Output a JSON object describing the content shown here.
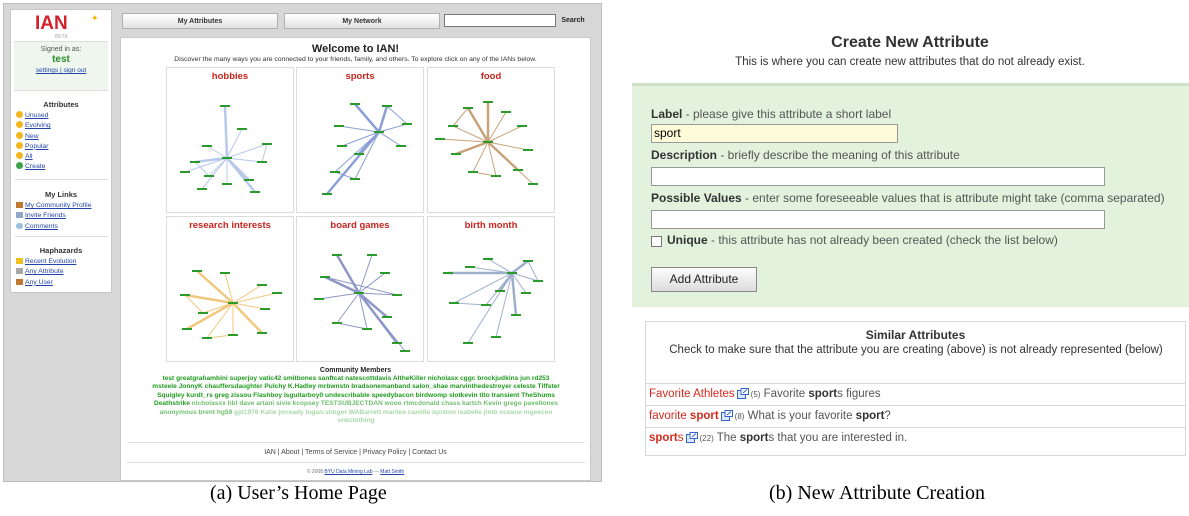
{
  "left_panel": {
    "logo": "IAN",
    "beta": "BETA",
    "signed_in_as": "Signed in as:",
    "username": "test",
    "settings": "settings",
    "sign_out": "sign out",
    "attributes_title": "Attributes",
    "attributes": [
      "Unused",
      "Evolving",
      "New",
      "Popular",
      "All",
      "Create"
    ],
    "links_title": "My Links",
    "links": [
      "My Community Profile",
      "Invite Friends",
      "Comments"
    ],
    "hap_title": "Haphazards",
    "haphazards": [
      "Recent Evolution",
      "Any Attribute",
      "Any User"
    ],
    "tabs": [
      "My Attributes",
      "My Network"
    ],
    "search_button": "Search",
    "welcome": "Welcome to IAN!",
    "discover": "Discover the many ways you are connected to your friends, family, and others. To explore click on any of the IANs below.",
    "graphs": [
      "hobbies",
      "sports",
      "food",
      "research interests",
      "board games",
      "birth month"
    ],
    "community_title": "Community Members",
    "members": [
      "test",
      "greatgrahambini",
      "superjoy",
      "vatic42",
      "smitbones",
      "sanftcat",
      "natescottdavis",
      "AltheKiller",
      "nicholasx",
      "cggc",
      "brockjudkins",
      "jun",
      "rd253",
      "msteele",
      "JonnyK",
      "chauffersdaughter",
      "Pulchy",
      "K.Hadley",
      "mrbwnstn",
      "bradsonemanband",
      "salon_shae",
      "marvinthedestroyer",
      "celeste",
      "Tiffster",
      "Squigley",
      "kurdt_rs",
      "greg",
      "zissou",
      "Flashboy",
      "Isguitarboy0",
      "undescribable",
      "speedybacon",
      "birdwomp",
      "slotkevin",
      "tito",
      "transient",
      "TheShums",
      "Deathstrike",
      "nicholasxx",
      "hbl",
      "dave",
      "artani",
      "sivie",
      "kcopsey",
      "TESTSUBJECTDAN",
      "wooo",
      "rtmcdonald",
      "chass",
      "kartch",
      "Kevin",
      "grego",
      "paveltones",
      "anonymous",
      "brent",
      "hg59",
      "gjd1976",
      "Katie",
      "jmready",
      "logan.stinger",
      "WABarrett",
      "marilee",
      "camille",
      "bpixton",
      "isabelle",
      "jimb",
      "oceane",
      "mgeecen",
      "snkclothing"
    ],
    "footer": "IAN | About | Terms of Service | Privacy Policy | Contact Us",
    "copyright_prefix": "© 2008",
    "copyright_lab": "BYU Data Mining Lab",
    "copyright_sep": "—",
    "copyright_author": "Matt Smith"
  },
  "right_panel": {
    "title": "Create New Attribute",
    "subtitle": "This is where you can create new attributes that do not already exist.",
    "label_name": "Label",
    "label_hint": " - please give this attribute a short label",
    "label_value": "sport",
    "desc_name": "Description",
    "desc_hint": " - briefly describe the meaning of this attribute",
    "desc_value": "",
    "values_name": "Possible Values",
    "values_hint": " - enter some foreseeable values that is attribute might take (comma separated)",
    "values_value": "",
    "unique_name": "Unique",
    "unique_hint": " - this attribute has not already been created (check the list below)",
    "unique_checked": false,
    "add_button": "Add Attribute",
    "similar_title": "Similar Attributes",
    "similar_desc": "Check to make sure that the attribute you are creating (above) is not already represented (below)",
    "similar": [
      {
        "pre": "Favorite Athletes",
        "bold": "",
        "post": "",
        "count": "(5)",
        "d_pre": "Favorite ",
        "d_bold": "sport",
        "d_post": "s figures"
      },
      {
        "pre": "favorite ",
        "bold": "sport",
        "post": "",
        "count": "(8)",
        "d_pre": "What is your favorite ",
        "d_bold": "sport",
        "d_post": "?"
      },
      {
        "pre": "",
        "bold": "sport",
        "post": "s",
        "count": "(22)",
        "d_pre": "The ",
        "d_bold": "sport",
        "d_post": "s that you are interested in."
      }
    ]
  },
  "captions": {
    "a": "(a) User’s Home Page",
    "b": "(b) New Attribute Creation"
  },
  "colors": {
    "accent_red": "#c9241c",
    "member_green": "#1f9a1f",
    "form_bg": "#e2f2dc",
    "link_blue": "#2244aa"
  }
}
